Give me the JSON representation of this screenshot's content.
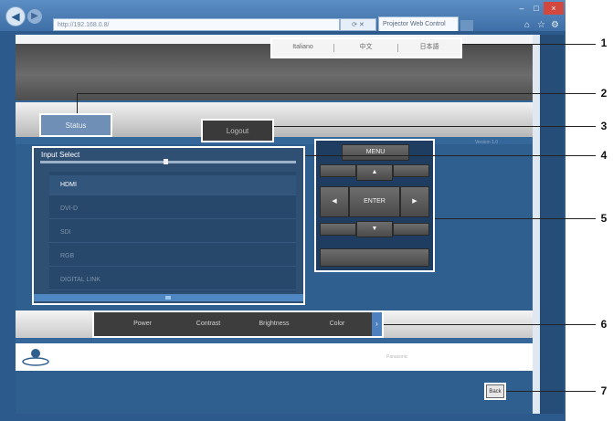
{
  "browser": {
    "address": "http://192.168.0.8/",
    "tab_title": "Projector Web Control",
    "window_controls": [
      "–",
      "□",
      "×"
    ],
    "icons": [
      "back-icon",
      "forward-icon",
      "home-icon",
      "star-icon",
      "gear-icon"
    ]
  },
  "header": {
    "languages": [
      "Italiano",
      "中文",
      "日本語"
    ]
  },
  "toolbar": {
    "status_label": "Status",
    "logout_label": "Logout"
  },
  "version_text": "Version 1.0",
  "input_select": {
    "title": "Input Select",
    "items": [
      "HDMI",
      "DVI-D",
      "SDI",
      "RGB",
      "DIGITAL LINK"
    ],
    "selected": "HDMI"
  },
  "control": {
    "menu_label": "MENU",
    "enter_label": "ENTER",
    "up_arrow": "▲",
    "down_arrow": "▼",
    "left_arrow": "◀",
    "right_arrow": "▶"
  },
  "function_tabs": [
    "Power",
    "Contrast",
    "Brightness",
    "Color"
  ],
  "function_next_arrow": "›",
  "footer": {
    "brand_text": "Panasonic"
  },
  "back_label": "Back",
  "callouts": [
    "1",
    "2",
    "3",
    "4",
    "5",
    "6",
    "7"
  ],
  "colors": {
    "page_blue": "#35679a",
    "accent_blue": "#4c80bf",
    "panel_dark": "#1f3d60"
  }
}
